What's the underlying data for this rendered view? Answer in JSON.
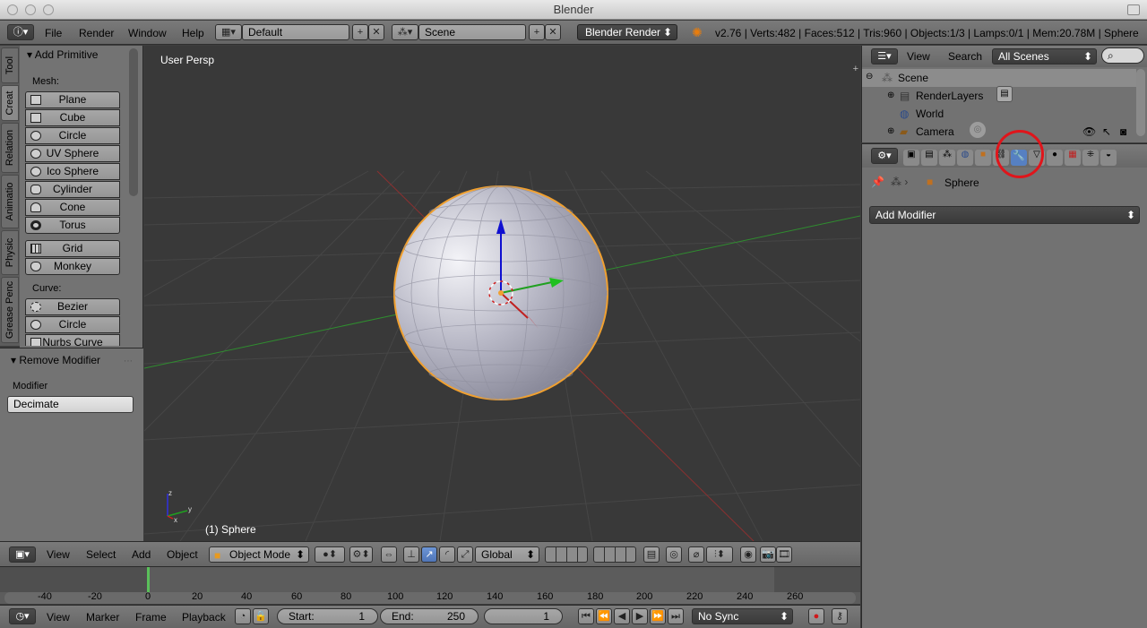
{
  "window_title": "Blender",
  "info_header": {
    "menus": [
      "File",
      "Render",
      "Window",
      "Help"
    ],
    "screen_layout": "Default",
    "scene": "Scene",
    "render_engine": "Blender Render",
    "stats": "v2.76 | Verts:482 | Faces:512 | Tris:960 | Objects:1/3 | Lamps:0/1 | Mem:20.78M | Sphere"
  },
  "tool_shelf": {
    "tabs": [
      "Tool",
      "Creat",
      "Relation",
      "Animatio",
      "Physic",
      "Grease Penc"
    ],
    "panel_title": "Add Primitive",
    "mesh_label": "Mesh:",
    "mesh_buttons": [
      "Plane",
      "Cube",
      "Circle",
      "UV Sphere",
      "Ico Sphere",
      "Cylinder",
      "Cone",
      "Torus"
    ],
    "mesh_buttons_2": [
      "Grid",
      "Monkey"
    ],
    "curve_label": "Curve:",
    "curve_buttons": [
      "Bezier",
      "Circle",
      "Nurbs Curve"
    ],
    "operator_panel_title": "Remove Modifier",
    "operator_field_label": "Modifier",
    "operator_field_value": "Decimate"
  },
  "viewport": {
    "view_label": "User Persp",
    "object_label": "(1) Sphere"
  },
  "view3d_header": {
    "menus": [
      "View",
      "Select",
      "Add",
      "Object"
    ],
    "mode": "Object Mode",
    "orientation": "Global"
  },
  "timeline": {
    "ticks": [
      "-40",
      "-20",
      "0",
      "20",
      "40",
      "60",
      "80",
      "100",
      "120",
      "140",
      "160",
      "180",
      "200",
      "220",
      "240",
      "260"
    ],
    "current_frame": 1,
    "menus": [
      "View",
      "Marker",
      "Frame",
      "Playback"
    ],
    "start_label": "Start:",
    "start_value": "1",
    "end_label": "End:",
    "end_value": "250",
    "frame_value": "1",
    "sync": "No Sync"
  },
  "outliner": {
    "menus": [
      "View",
      "Search"
    ],
    "filter": "All Scenes",
    "items": [
      "Scene",
      "RenderLayers",
      "World",
      "Camera"
    ]
  },
  "properties": {
    "context_object": "Sphere",
    "add_modifier_label": "Add Modifier"
  },
  "colors": {
    "selection_outline": "#f0a030",
    "highlight_circle": "#e0151b",
    "active_tab": "#5680c2"
  }
}
